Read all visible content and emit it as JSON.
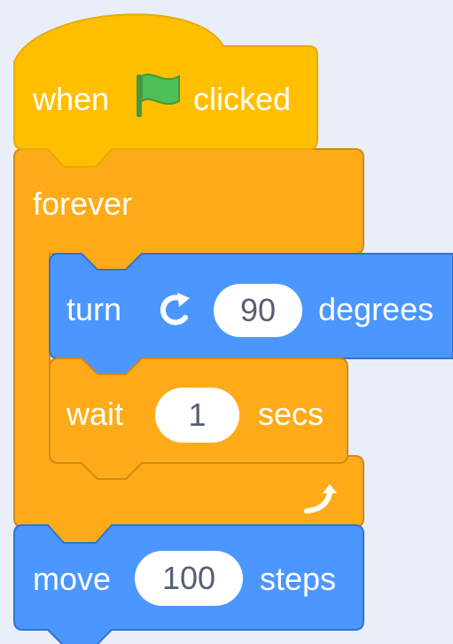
{
  "workspace": {
    "background": "#e9eef8"
  },
  "colors": {
    "events": "#ffbf00",
    "events_stroke": "#e6ac00",
    "control": "#ffab19",
    "control_stroke": "#cf8b17",
    "motion": "#4c97ff",
    "motion_stroke": "#3373cc",
    "flag_green": "#4cbf56"
  },
  "blocks": {
    "hat": {
      "prefix": "when",
      "icon": "green-flag-icon",
      "suffix": "clicked"
    },
    "forever": {
      "label": "forever",
      "end_icon": "loop-arrow-icon"
    },
    "turn": {
      "label": "turn",
      "icon": "rotate-clockwise-icon",
      "value": "90",
      "unit": "degrees"
    },
    "wait": {
      "label": "wait",
      "value": "1",
      "unit": "secs"
    },
    "move": {
      "label": "move",
      "value": "100",
      "unit": "steps"
    }
  }
}
